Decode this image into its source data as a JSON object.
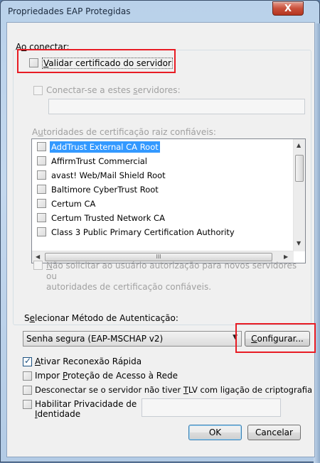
{
  "window": {
    "title": "Propriedades EAP Protegidas",
    "close_label": "X"
  },
  "connect": {
    "group_label_pre": "A",
    "group_label_u": "o",
    "group_label_post": " conectar:",
    "validate_cert": {
      "label_u": "V",
      "label_rest": "alidar certificado do servidor",
      "checked": false
    },
    "connect_servers": {
      "label_pre": "Conectar-se a estes ",
      "label_u": "s",
      "label_post": "ervidores:",
      "value": ""
    },
    "root_ca": {
      "label_pre": "A",
      "label_u": "u",
      "label_post": "toridades de certificação raiz confiáveis:",
      "items": [
        {
          "label": "AddTrust External CA Root",
          "selected": true
        },
        {
          "label": "AffirmTrust Commercial",
          "selected": false
        },
        {
          "label": "avast! Web/Mail Shield Root",
          "selected": false
        },
        {
          "label": "Baltimore CyberTrust Root",
          "selected": false
        },
        {
          "label": "Certum CA",
          "selected": false
        },
        {
          "label": "Certum Trusted Network CA",
          "selected": false
        },
        {
          "label": "Class 3 Public Primary Certification Authority",
          "selected": false
        }
      ],
      "hscroll_grip": "III"
    },
    "no_prompt": {
      "label_u": "N",
      "label_line1_rest": "ão solicitar ao usuário autorização para novos servidores ou",
      "label_line2": "autoridades de certificação confiáveis."
    }
  },
  "auth": {
    "label_pre": "S",
    "label_u": "e",
    "label_post": "lecionar Método de Autenticação:",
    "method_value": "Senha segura (EAP-MSCHAP v2)",
    "configure_u": "C",
    "configure_rest": "onfigurar..."
  },
  "options": {
    "fast_reconnect": {
      "u": "A",
      "rest": "tivar Reconexão Rápida",
      "checked": true
    },
    "nap": {
      "pre": "Impor ",
      "u": "P",
      "post": "roteção de Acesso à Rede",
      "checked": false
    },
    "disconnect_tlv": {
      "pre": "Desconectar se o servidor não tiver ",
      "u": "T",
      "post": "LV com ligação de criptografia",
      "checked": false
    },
    "identity_privacy": {
      "line1": "Habilitar Privacidade de",
      "line2_u": "I",
      "line2_rest": "dentidade",
      "value": "",
      "checked": false
    }
  },
  "buttons": {
    "ok": "OK",
    "cancel": "Cancelar"
  }
}
